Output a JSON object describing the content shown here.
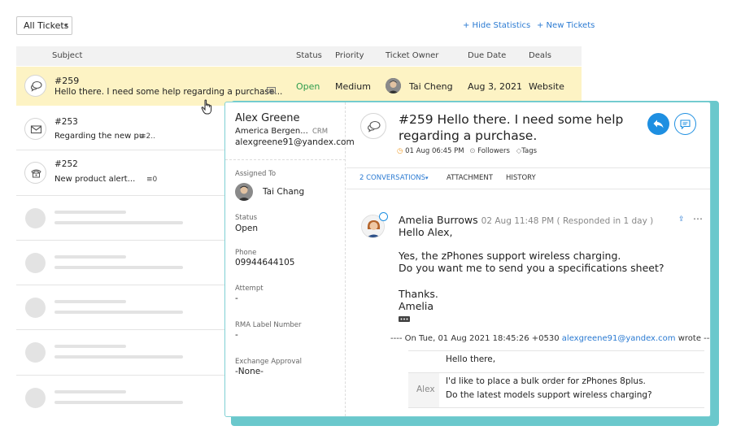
{
  "toolbar": {
    "filter_label": "All Tickets",
    "hide_statistics": "+ Hide Statistics",
    "new_tickets": "+ New Tickets"
  },
  "table": {
    "headers": {
      "subject": "Subject",
      "status": "Status",
      "priority": "Priority",
      "owner": "Ticket Owner",
      "due": "Due Date",
      "deals": "Deals"
    },
    "rows": [
      {
        "number": "#259",
        "subject": "Hello there. I need some help regarding a purchase...",
        "status": "Open",
        "priority": "Medium",
        "owner": "Tai Cheng",
        "due": "Aug 3, 2021",
        "deals": "Website",
        "channel_icon": "chat-icon"
      },
      {
        "number": "#253",
        "subject": "Regarding the new pu",
        "thread_count": "2..",
        "channel_icon": "mail-icon"
      },
      {
        "number": "#252",
        "subject": "New product alert...",
        "thread_count": "0",
        "channel_icon": "phone-icon"
      }
    ]
  },
  "panel": {
    "contact": {
      "name": "Alex Greene",
      "account": "America Bergen...",
      "crm_tag": "CRM",
      "email": "alexgreene91@yandex.com"
    },
    "fields": {
      "assigned_label": "Assigned To",
      "assigned_value": "Tai Chang",
      "status_label": "Status",
      "status_value": "Open",
      "phone_label": "Phone",
      "phone_value": "09944644105",
      "attempt_label": "Attempt",
      "attempt_value": "-",
      "rma_label": "RMA Label Number",
      "rma_value": "-",
      "exchange_label": "Exchange Approval",
      "exchange_value": "-None-"
    },
    "ticket": {
      "title_line1": "#259 Hello there. I need some help",
      "title_line2": "regarding a purchase.",
      "created": "01 Aug 06:45 PM",
      "followers": "Followers",
      "tags": "Tags"
    },
    "tabs": {
      "conversations": "2 CONVERSATIONS",
      "attachment": "ATTACHMENT",
      "history": "HISTORY"
    },
    "message": {
      "sender": "Amelia Burrows",
      "meta": "02 Aug 11:48 PM ( Responded in 1 day )",
      "lines": [
        "Hello Alex,",
        "Yes, the zPhones support wireless charging.",
        "Do you want me to send you a specifications sheet?",
        "Thanks.",
        "Amelia"
      ],
      "quote_header_prefix": "---- On Tue, 01 Aug 2021 18:45:26 +0530",
      "quote_header_email": "alexgreene91@yandex.com",
      "quote_header_suffix": "wrote ----",
      "quote_author": "Alex",
      "quote_lines": [
        "Hello there,",
        "I'd like to place a bulk order for zPhones 8plus.",
        "Do the latest models support wireless charging?"
      ]
    }
  },
  "colors": {
    "accent": "#2a7ad2",
    "status_open": "#2e9d4e",
    "active_row": "#fdf3c4",
    "panel_border": "#6ac8cc"
  }
}
